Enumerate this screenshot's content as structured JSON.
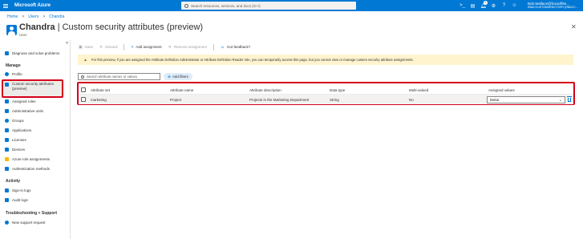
{
  "topbar": {
    "brand": "Microsoft Azure",
    "search_placeholder": "Search resources, services, and docs (G+/)",
    "notification_count": "1",
    "account_name": "Bob.Wallace@fcsaciflite...",
    "account_tenant": "RBACCUSTOMDIRECTORY (RBACC..."
  },
  "breadcrumb": {
    "home": "Home",
    "sep1": ">",
    "users": "Users",
    "sep2": ">",
    "current": "Chandra"
  },
  "page": {
    "name": "Chandra",
    "divider": "|",
    "title": "Custom security attributes (preview)",
    "subtitle": "User",
    "more": "...",
    "close": "✕"
  },
  "sidebar": {
    "collapse": "«",
    "items": [
      {
        "label": "Diagnose and solve problems",
        "color": "#0078d4"
      },
      {
        "label": "Profile",
        "color": "#0078d4"
      },
      {
        "label": "Custom security attributes (preview)",
        "color": "#0078d4"
      },
      {
        "label": "Assigned roles",
        "color": "#0078d4"
      },
      {
        "label": "Administrative units",
        "color": "#0078d4"
      },
      {
        "label": "Groups",
        "color": "#0078d4"
      },
      {
        "label": "Applications",
        "color": "#0078d4"
      },
      {
        "label": "Licenses",
        "color": "#0078d4"
      },
      {
        "label": "Devices",
        "color": "#0078d4"
      },
      {
        "label": "Azure role assignments",
        "color": "#ffb900"
      },
      {
        "label": "Authentication methods",
        "color": "#0078d4"
      },
      {
        "label": "Sign-in logs",
        "color": "#0078d4"
      },
      {
        "label": "Audit logs",
        "color": "#0078d4"
      },
      {
        "label": "New support request",
        "color": "#0078d4"
      }
    ],
    "sections": {
      "manage": "Manage",
      "activity": "Activity",
      "troubleshooting": "Troubleshooting + Support"
    }
  },
  "toolbar": {
    "save": "Save",
    "discard": "Discard",
    "add_assignment": "Add assignment",
    "remove_assignment": "Remove assignment",
    "feedback": "Got feedback?"
  },
  "notice": {
    "text": "For this preview, if you are assigned the Attribute Definition Administrator or Attribute Definition Reader role, you can temporarily access this page, but you cannot view or manage custom security attribute assignments."
  },
  "filter": {
    "placeholder": "Search attribute names or values",
    "add_filters": "Add filters"
  },
  "table": {
    "columns": [
      "Attribute set",
      "Attribute name",
      "Attribute description",
      "Data type",
      "Multi-valued",
      "Assigned values"
    ],
    "rows": [
      {
        "attribute_set": "marketing",
        "attribute_name": "Project",
        "description": "Projects in the Marketing Department",
        "data_type": "String",
        "multi_valued": "No",
        "assigned_value": "Bakar"
      }
    ]
  },
  "colors": {
    "accent": "#0078d4",
    "highlight": "#d6001c",
    "notice_bg": "#fff4ce"
  }
}
